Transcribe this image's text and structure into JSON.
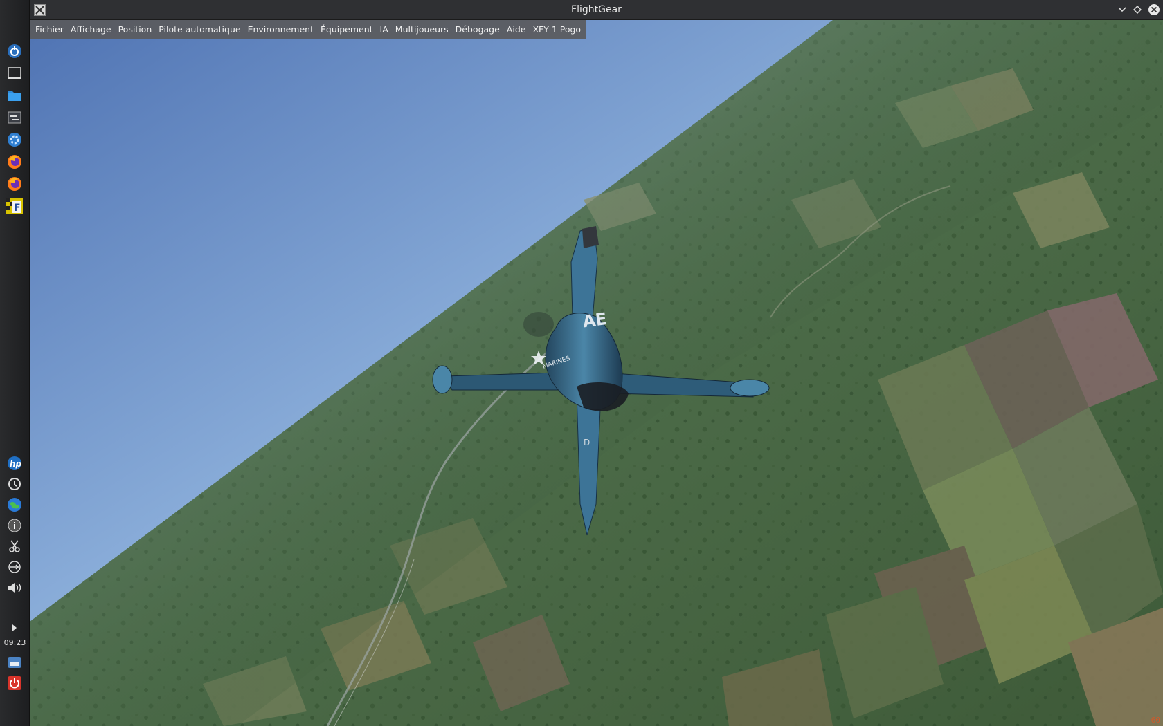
{
  "window": {
    "title": "FlightGear"
  },
  "menubar": {
    "items": [
      "Fichier",
      "Affichage",
      "Position",
      "Pilote automatique",
      "Environnement",
      "Équipement",
      "IA",
      "Multijoueurs",
      "Débogage",
      "Aide",
      "XFY 1 Pogo"
    ]
  },
  "aircraft": {
    "tail_code": "AE",
    "fuselage_text": "MARINES",
    "lower_fin_code": "D",
    "color": "#3d6f8a"
  },
  "hud": {
    "fps": "60"
  },
  "taskbar": {
    "clock": "09:23",
    "top_icons": [
      "launcher-icon",
      "desktop-icon",
      "folder-icon",
      "settings-panel-icon",
      "system-settings-icon",
      "firefox-icon",
      "firefox-icon-2",
      "flightgear-icon"
    ],
    "bottom_icons": [
      "hp-icon",
      "update-icon",
      "network-globe-icon",
      "info-icon",
      "scissors-icon",
      "usb-icon",
      "volume-icon",
      "expand-arrow-icon"
    ],
    "tray_icons": [
      "drive-icon",
      "power-icon"
    ]
  },
  "colors": {
    "sky_top": "#5f86c0",
    "sky_horizon": "#c8dcee",
    "terrain": "#4a6b48",
    "menubar_bg": "#5a5a5c"
  }
}
